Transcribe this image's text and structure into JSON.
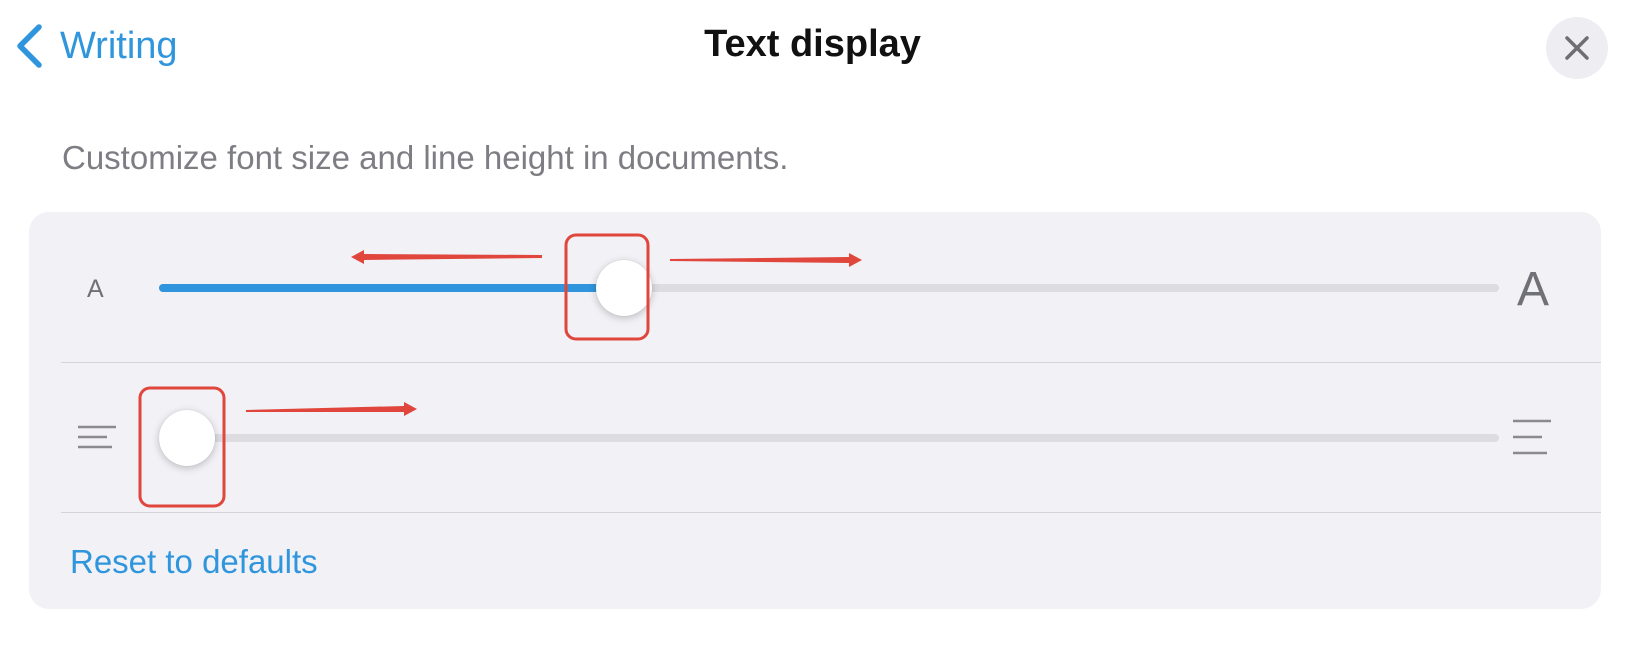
{
  "header": {
    "back_label": "Writing",
    "title": "Text display"
  },
  "description": "Customize font size and line height in documents.",
  "font_size": {
    "small_label": "A",
    "large_label": "A",
    "value": 0.34
  },
  "line_height": {
    "value": 0.0
  },
  "reset_label": "Reset to defaults",
  "colors": {
    "accent": "#2f95dc",
    "panel_bg": "#f1f1f6",
    "annotation": "#e0463c"
  },
  "icons": {
    "back": "chevron-left-icon",
    "close": "close-icon",
    "line_height_small": "lines-compact-icon",
    "line_height_large": "lines-spacious-icon"
  }
}
